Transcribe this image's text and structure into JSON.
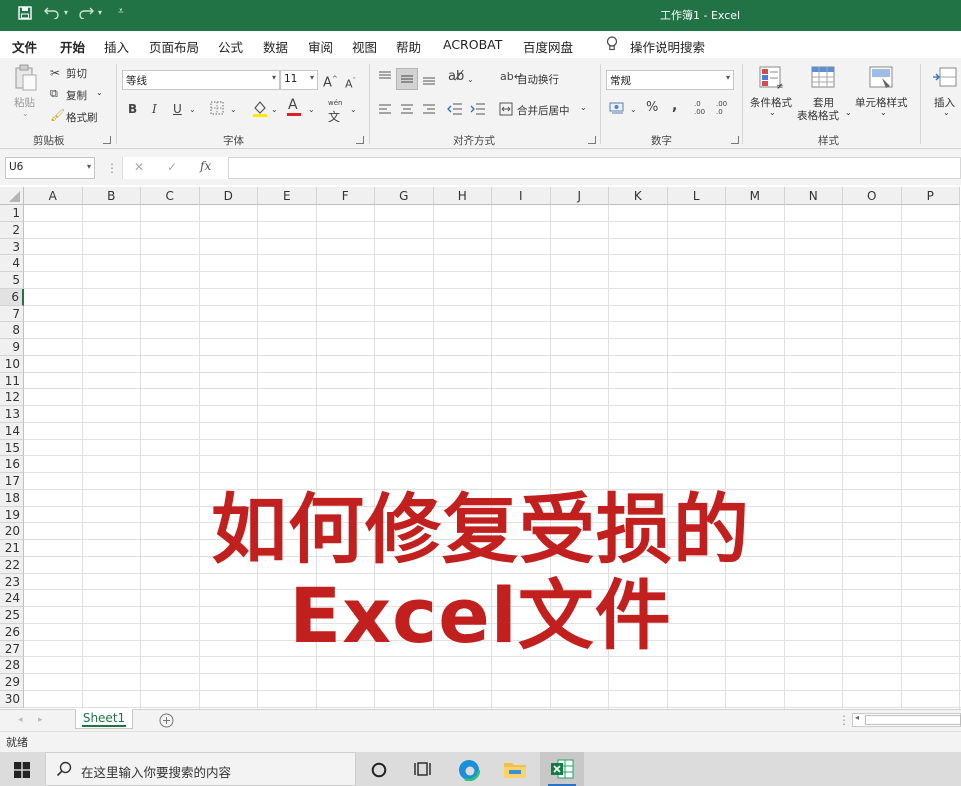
{
  "titlebar": {
    "title": "工作簿1  -  Excel",
    "accent": "#217346"
  },
  "tabs": [
    "文件",
    "开始",
    "插入",
    "页面布局",
    "公式",
    "数据",
    "审阅",
    "视图",
    "帮助",
    "ACROBAT",
    "百度网盘"
  ],
  "active_tab": "开始",
  "tell_me": "操作说明搜索",
  "ribbon": {
    "clipboard": {
      "paste": "粘贴",
      "cut": "剪切",
      "copy": "复制",
      "format_painter": "格式刷",
      "group": "剪贴板"
    },
    "font": {
      "name": "等线",
      "size": "11",
      "group": "字体",
      "bold": "B",
      "italic": "I",
      "underline": "U",
      "grow": "A",
      "shrink": "A",
      "font_color": "A",
      "phonetic": "wén"
    },
    "alignment": {
      "wrap": "自动换行",
      "merge": "合并后居中",
      "group": "对齐方式"
    },
    "number": {
      "format": "常规",
      "percent": "%",
      "comma": ",",
      "group": "数字",
      "inc_decimal": ".0\n.00",
      "dec_decimal": ".00\n.0"
    },
    "styles": {
      "conditional": "条件格式",
      "table_line1": "套用",
      "table_line2": "表格格式",
      "cell_styles": "单元格样式",
      "group": "样式"
    },
    "cells": {
      "insert": "插入"
    }
  },
  "formula_bar": {
    "name_box": "U6",
    "cancel": "✕",
    "confirm": "✓",
    "fx": "fx",
    "value": ""
  },
  "columns": [
    "A",
    "B",
    "C",
    "D",
    "E",
    "F",
    "G",
    "H",
    "I",
    "J",
    "K",
    "L",
    "M",
    "N",
    "O",
    "P"
  ],
  "rows": [
    "1",
    "2",
    "3",
    "4",
    "5",
    "6",
    "7",
    "8",
    "9",
    "10",
    "11",
    "12",
    "13",
    "14",
    "15",
    "16",
    "17",
    "18",
    "19",
    "20",
    "21",
    "22",
    "23",
    "24",
    "25",
    "26",
    "27",
    "28",
    "29",
    "30"
  ],
  "selected_row": "6",
  "overlay": {
    "line1": "如何修复受损的",
    "line2": "Excel文件",
    "color": "#c21f1f"
  },
  "sheets": [
    "Sheet1"
  ],
  "status": "就绪",
  "taskbar": {
    "search_placeholder": "在这里输入你要搜索的内容",
    "start_icon": "windows-logo-icon"
  }
}
